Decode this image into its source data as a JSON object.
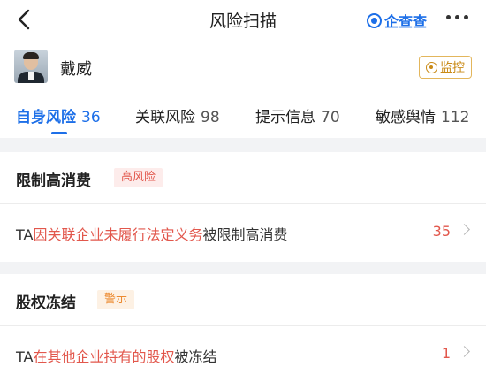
{
  "nav": {
    "title": "风险扫描",
    "brand": "企查查"
  },
  "person": {
    "name": "戴威",
    "monitor_label": "监控"
  },
  "tabs": [
    {
      "label": "自身风险",
      "count": "36"
    },
    {
      "label": "关联风险",
      "count": "98"
    },
    {
      "label": "提示信息",
      "count": "70"
    },
    {
      "label": "敏感舆情",
      "count": "112"
    }
  ],
  "sections": [
    {
      "title": "限制高消费",
      "tag": "高风险",
      "item": {
        "prefix": "TA",
        "highlight": "因关联企业未履行法定义务",
        "suffix": "被限制高消费",
        "count": "35"
      }
    },
    {
      "title": "股权冻结",
      "tag": "警示",
      "item": {
        "prefix": "TA",
        "highlight": "在其他企业持有的股权",
        "suffix": "被冻结",
        "count": "1"
      }
    }
  ],
  "colors": {
    "accent": "#1d6fe8",
    "risk": "#e2574c",
    "warning": "#ec8a30",
    "monitor": "#c98a16"
  }
}
